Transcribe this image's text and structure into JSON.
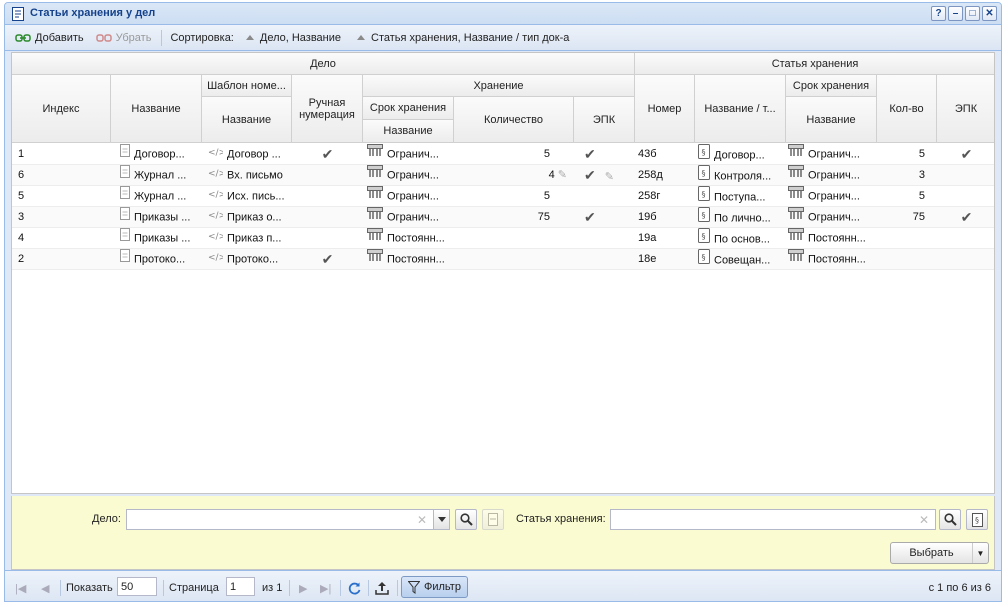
{
  "window": {
    "title": "Статьи хранения у дел"
  },
  "toolbar": {
    "add_label": "Добавить",
    "remove_label": "Убрать",
    "sort_label": "Сортировка:",
    "sort_items": [
      "Дело, Название",
      "Статья хранения, Название / тип док-а"
    ]
  },
  "headers": {
    "delo": "Дело",
    "statya": "Статья хранения",
    "index": "Индекс",
    "name": "Название",
    "template": "Шаблон номе...",
    "template_name": "Название",
    "manual": "Ручная нумерация",
    "storage": "Хранение",
    "storage_period": "Срок хранения",
    "storage_period_name": "Название",
    "quantity": "Количество",
    "epk": "ЭПК",
    "nomer": "Номер",
    "name_type": "Название / т...",
    "st_period": "Срок хранения",
    "st_period_name": "Название",
    "count": "Кол-во",
    "st_epk": "ЭПК"
  },
  "rows": [
    {
      "index": "1",
      "name": "Договор...",
      "template": "Договор ...",
      "manual": true,
      "period": "Огранич...",
      "qty": "5",
      "epk": true,
      "edit": false,
      "nomer": "43б",
      "st_name": "Договор...",
      "st_period": "Огранич...",
      "count": "5",
      "st_epk": true
    },
    {
      "index": "6",
      "name": "Журнал ...",
      "template": "Вх. письмо",
      "manual": false,
      "period": "Огранич...",
      "qty": "4",
      "epk": true,
      "edit": true,
      "nomer": "258д",
      "st_name": "Контроля...",
      "st_period": "Огранич...",
      "count": "3",
      "st_epk": false
    },
    {
      "index": "5",
      "name": "Журнал ...",
      "template": "Исх. пись...",
      "manual": false,
      "period": "Огранич...",
      "qty": "5",
      "epk": false,
      "edit": false,
      "nomer": "258г",
      "st_name": "Поступа...",
      "st_period": "Огранич...",
      "count": "5",
      "st_epk": false
    },
    {
      "index": "3",
      "name": "Приказы ...",
      "template": "Приказ о...",
      "manual": false,
      "period": "Огранич...",
      "qty": "75",
      "epk": true,
      "edit": false,
      "nomer": "19б",
      "st_name": "По лично...",
      "st_period": "Огранич...",
      "count": "75",
      "st_epk": true
    },
    {
      "index": "4",
      "name": "Приказы ...",
      "template": "Приказ п...",
      "manual": false,
      "period": "Постоянн...",
      "qty": "",
      "epk": false,
      "edit": false,
      "nomer": "19а",
      "st_name": "По основ...",
      "st_period": "Постоянн...",
      "count": "",
      "st_epk": false
    },
    {
      "index": "2",
      "name": "Протоко...",
      "template": "Протоко...",
      "manual": true,
      "period": "Постоянн...",
      "qty": "",
      "epk": false,
      "edit": false,
      "nomer": "18е",
      "st_name": "Совещан...",
      "st_period": "Постоянн...",
      "count": "",
      "st_epk": false
    }
  ],
  "filter": {
    "delo_label": "Дело:",
    "delo_value": "",
    "statya_label": "Статья хранения:",
    "statya_value": "",
    "select_label": "Выбрать"
  },
  "pager": {
    "show_label": "Показать",
    "page_size": "50",
    "page_label": "Страница",
    "page": "1",
    "of_label": "из 1",
    "filter_label": "Фильтр",
    "summary": "с 1 по 6 из 6"
  },
  "icons": {
    "doc": "document-icon",
    "template": "code-icon",
    "period": "archive-icon",
    "article": "article-icon",
    "check": "check-icon"
  }
}
